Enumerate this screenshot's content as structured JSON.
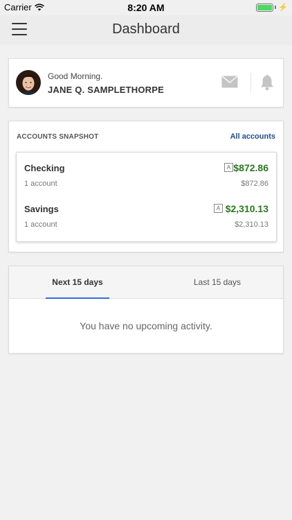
{
  "status_bar": {
    "carrier": "Carrier",
    "time": "8:20 AM",
    "battery_level": 1.0,
    "battery_color": "#4cd964"
  },
  "nav": {
    "title": "Dashboard",
    "menu_icon": "hamburger-menu-icon"
  },
  "profile": {
    "greeting": "Good Morning.",
    "name": "JANE Q. SAMPLETHORPE",
    "mail_icon": "mail-icon",
    "bell_icon": "bell-icon"
  },
  "snapshot": {
    "title": "ACCOUNTS SNAPSHOT",
    "all_accounts_label": "All accounts",
    "accounts": [
      {
        "name": "Checking",
        "sub": "1 account",
        "badge": "A",
        "amount": "$872.86",
        "amount_sub": "$872.86"
      },
      {
        "name": "Savings",
        "sub": "1 account",
        "badge": "A",
        "amount": "$2,310.13",
        "amount_sub": "$2,310.13"
      }
    ]
  },
  "activity": {
    "tabs": [
      {
        "label": "Next 15 days",
        "active": true
      },
      {
        "label": "Last 15 days",
        "active": false
      }
    ],
    "empty_message": "You have no upcoming activity."
  },
  "colors": {
    "accent_blue": "#2f6fd6",
    "link_blue": "#1f4d8c",
    "amount_green": "#2a7a1e"
  }
}
